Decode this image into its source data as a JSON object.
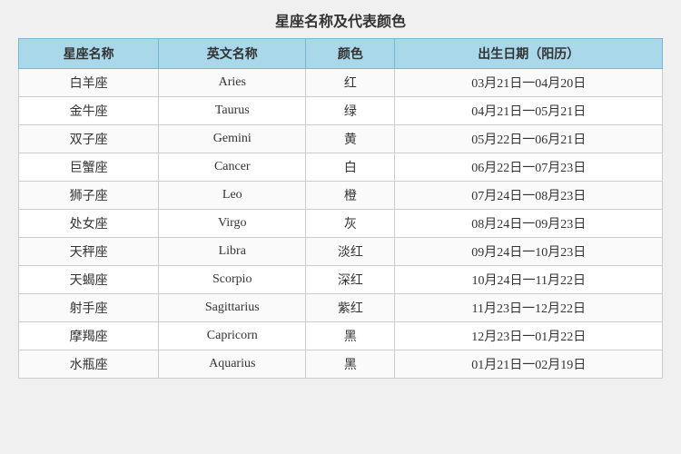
{
  "title": "星座名称及代表颜色",
  "headers": [
    "星座名称",
    "英文名称",
    "颜色",
    "出生日期（阳历）"
  ],
  "rows": [
    {
      "chinese": "白羊座",
      "english": "Aries",
      "color": "红",
      "date": "03月21日一04月20日"
    },
    {
      "chinese": "金牛座",
      "english": "Taurus",
      "color": "绿",
      "date": "04月21日一05月21日"
    },
    {
      "chinese": "双子座",
      "english": "Gemini",
      "color": "黄",
      "date": "05月22日一06月21日"
    },
    {
      "chinese": "巨蟹座",
      "english": "Cancer",
      "color": "白",
      "date": "06月22日一07月23日"
    },
    {
      "chinese": "狮子座",
      "english": "Leo",
      "color": "橙",
      "date": "07月24日一08月23日"
    },
    {
      "chinese": "处女座",
      "english": "Virgo",
      "color": "灰",
      "date": "08月24日一09月23日"
    },
    {
      "chinese": "天秤座",
      "english": "Libra",
      "color": "淡红",
      "date": "09月24日一10月23日"
    },
    {
      "chinese": "天蝎座",
      "english": "Scorpio",
      "color": "深红",
      "date": "10月24日一11月22日"
    },
    {
      "chinese": "射手座",
      "english": "Sagittarius",
      "color": "紫红",
      "date": "11月23日一12月22日"
    },
    {
      "chinese": "摩羯座",
      "english": "Capricorn",
      "color": "黑",
      "date": "12月23日一01月22日"
    },
    {
      "chinese": "水瓶座",
      "english": "Aquarius",
      "color": "黑",
      "date": "01月21日一02月19日"
    }
  ]
}
